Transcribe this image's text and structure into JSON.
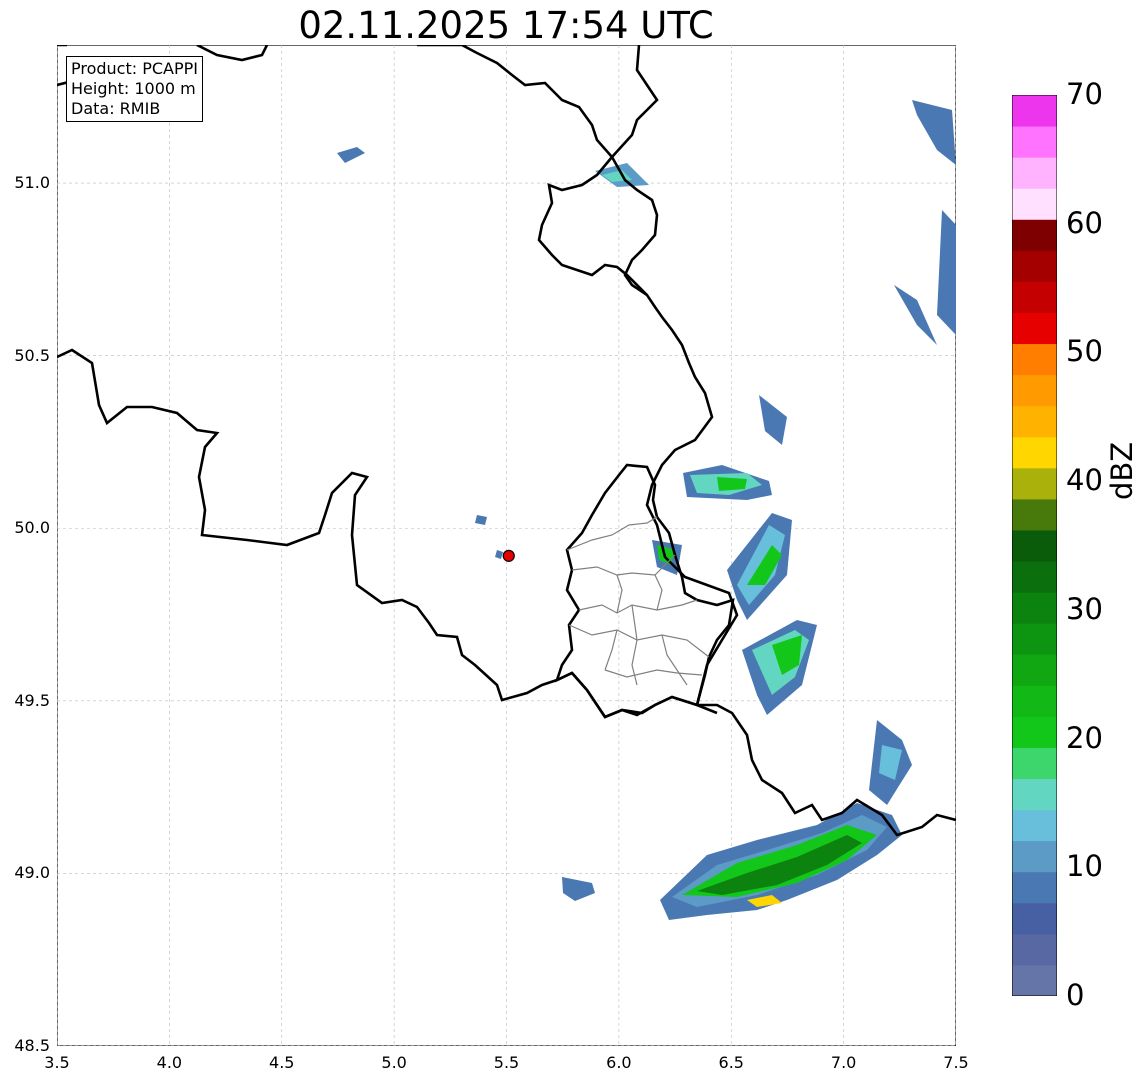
{
  "title": "02.11.2025 17:54 UTC",
  "info": {
    "product": "Product: PCAPPI",
    "height": "Height: 1000 m",
    "data": "Data: RMIB"
  },
  "axes": {
    "x_ticks": [
      "3.5",
      "4.0",
      "4.5",
      "5.0",
      "5.5",
      "6.0",
      "6.5",
      "7.0",
      "7.5"
    ],
    "y_ticks": [
      "51.0",
      "50.5",
      "50.0",
      "49.5",
      "49.0",
      "48.5"
    ],
    "x_values": [
      3.5,
      4.0,
      4.5,
      5.0,
      5.5,
      6.0,
      6.5,
      7.0,
      7.5
    ],
    "y_values": [
      51.0,
      50.5,
      50.0,
      49.5,
      49.0,
      48.5
    ],
    "lon_range": [
      3.5,
      7.5
    ],
    "lat_range": [
      48.5,
      51.4
    ],
    "grid": "on"
  },
  "radar_site": {
    "lon": 5.51,
    "lat": 49.92,
    "color": "#e60000"
  },
  "colorbar": {
    "label": "dBZ",
    "ticks": [
      "0",
      "10",
      "20",
      "30",
      "40",
      "50",
      "60",
      "70"
    ],
    "range": [
      0,
      70
    ],
    "colors": [
      "#6675a8",
      "#5868a2",
      "#475fa3",
      "#4a78b3",
      "#5b9bc6",
      "#68bfdb",
      "#62d6c0",
      "#3dd66c",
      "#13c71a",
      "#11b816",
      "#10a713",
      "#0d9511",
      "#0c820f",
      "#0a6f0c",
      "#0a5c0a",
      "#477a0a",
      "#aab10a",
      "#ffd600",
      "#ffb300",
      "#ff9a00",
      "#ff7e00",
      "#e60000",
      "#c40000",
      "#a50000",
      "#7e0000",
      "#ffe0ff",
      "#ffb3ff",
      "#ff73ff",
      "#ee35ee"
    ]
  },
  "colors": {
    "border": "#000000",
    "admin": "#808080",
    "grid": "#bbbbbb"
  }
}
